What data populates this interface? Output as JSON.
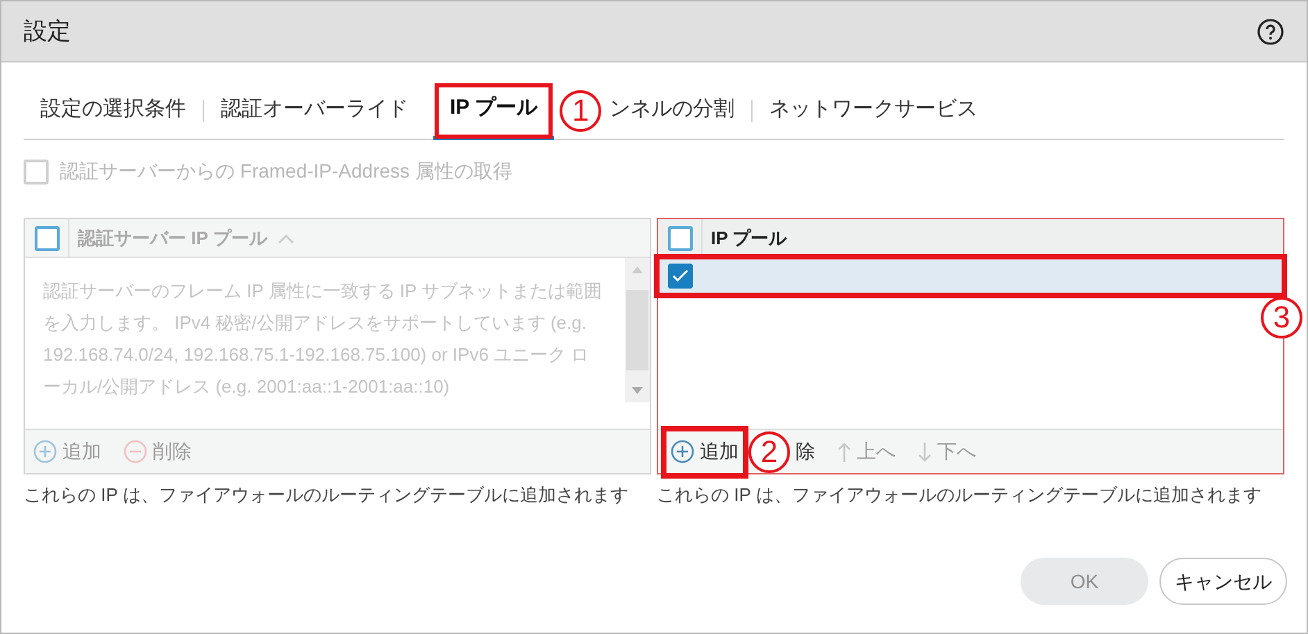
{
  "window": {
    "title": "設定"
  },
  "tabs": [
    {
      "label": "設定の選択条件",
      "selected": false
    },
    {
      "label": "認証オーバーライド",
      "selected": false
    },
    {
      "label": "IP プール",
      "selected": true,
      "callout": "1"
    },
    {
      "label": "ンネルの分割",
      "selected": false
    },
    {
      "label": "ネットワークサービス",
      "selected": false
    }
  ],
  "framed_ip_option": {
    "label": "認証サーバーからの Framed-IP-Address 属性の取得",
    "checked": false,
    "disabled": true
  },
  "left_panel": {
    "header": {
      "label": "認証サーバー IP プール",
      "checked": false
    },
    "placeholder": "認証サーバーのフレーム IP 属性に一致する IP サブネットまたは範囲を入力します。 IPv4 秘密/公開アドレスをサポートしています (e.g. 192.168.74.0/24, 192.168.75.1-192.168.75.100) or IPv6 ユニーク ローカル/公開アドレス (e.g. 2001:aa::1-2001:aa::10)",
    "actions": [
      {
        "kind": "add",
        "label": "追加",
        "disabled": true
      },
      {
        "kind": "remove",
        "label": "削除",
        "disabled": true
      }
    ],
    "note": "これらの IP は、ファイアウォールのルーティングテーブルに追加されます"
  },
  "right_panel": {
    "header": {
      "label": "IP プール",
      "checked": false
    },
    "rows": [
      {
        "checked": true,
        "selected": true,
        "callout": "3"
      }
    ],
    "actions": [
      {
        "kind": "add",
        "label": "追加",
        "disabled": false,
        "callout": "2"
      },
      {
        "kind": "remove",
        "label": "除",
        "disabled": false
      },
      {
        "kind": "up",
        "label": "上へ",
        "disabled": true
      },
      {
        "kind": "down",
        "label": "下へ",
        "disabled": true
      }
    ],
    "note": "これらの IP は、ファイアウォールのルーティングテーブルに追加されます"
  },
  "buttons": [
    {
      "kind": "ok",
      "label": "OK",
      "disabled": true
    },
    {
      "kind": "cancel",
      "label": "キャンセル",
      "disabled": false
    }
  ]
}
